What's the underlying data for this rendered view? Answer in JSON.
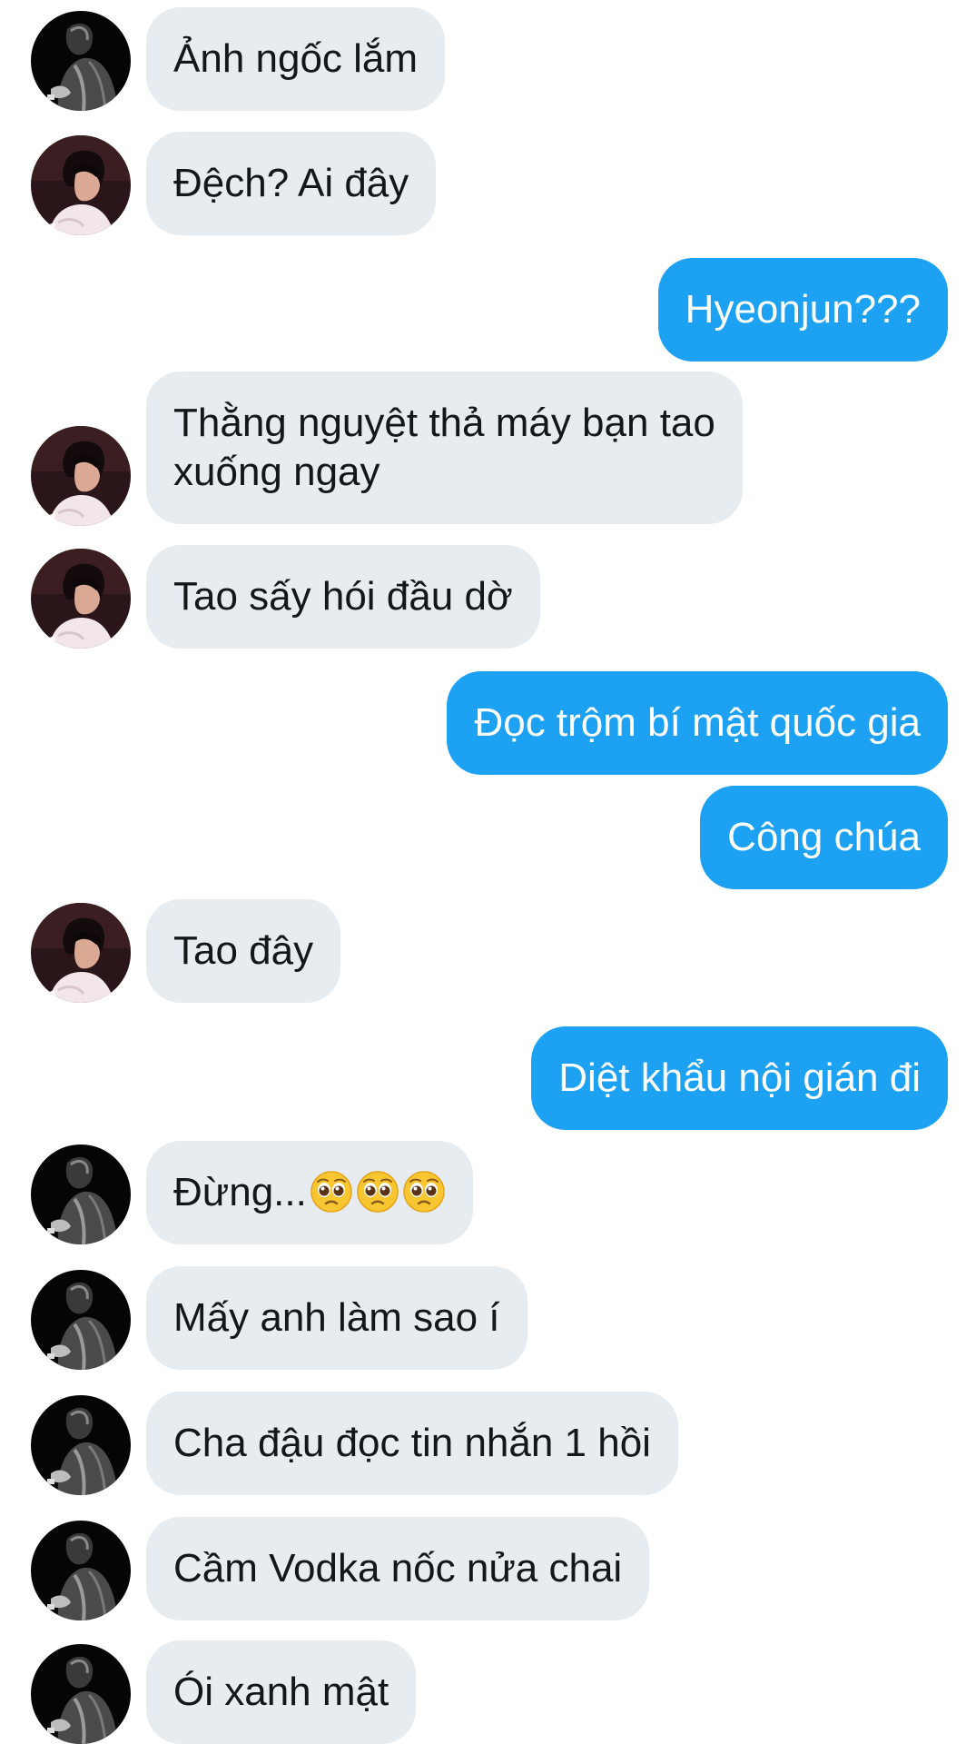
{
  "messages": [
    {
      "side": "in",
      "avatar": "avatar-dark",
      "text": "Ảnh ngốc lắm"
    },
    {
      "side": "in",
      "avatar": "avatar-light",
      "text": "Đệch? Ai đây"
    },
    {
      "side": "out",
      "text": "Hyeonjun???"
    },
    {
      "side": "in",
      "avatar": "avatar-light",
      "line1": "Thằng nguyệt thả máy bạn tao",
      "line2": "xuống ngay"
    },
    {
      "side": "in",
      "avatar": "avatar-light",
      "text": "Tao sấy hói đầu dờ"
    },
    {
      "side": "out",
      "text": "Đọc trộm bí mật quốc gia"
    },
    {
      "side": "out",
      "text": "Công chúa"
    },
    {
      "side": "in",
      "avatar": "avatar-light",
      "text": "Tao đây"
    },
    {
      "side": "out",
      "text": "Diệt khẩu nội gián đi"
    },
    {
      "side": "in",
      "avatar": "avatar-dark",
      "text": "Đừng...",
      "emoji": [
        "pleading-face-icon",
        "pleading-face-icon",
        "pleading-face-icon"
      ]
    },
    {
      "side": "in",
      "avatar": "avatar-dark",
      "text": "Mấy anh làm sao í"
    },
    {
      "side": "in",
      "avatar": "avatar-dark",
      "text": "Cha đậu đọc tin nhắn 1 hồi"
    },
    {
      "side": "in",
      "avatar": "avatar-dark",
      "text": "Cầm Vodka nốc nửa chai"
    },
    {
      "side": "in",
      "avatar": "avatar-dark",
      "text": "Ói xanh mật"
    }
  ],
  "colors": {
    "incoming_bubble": "#e6ecf0",
    "outgoing_bubble": "#1da1f2",
    "incoming_text": "#14171a",
    "outgoing_text": "#ffffff"
  }
}
